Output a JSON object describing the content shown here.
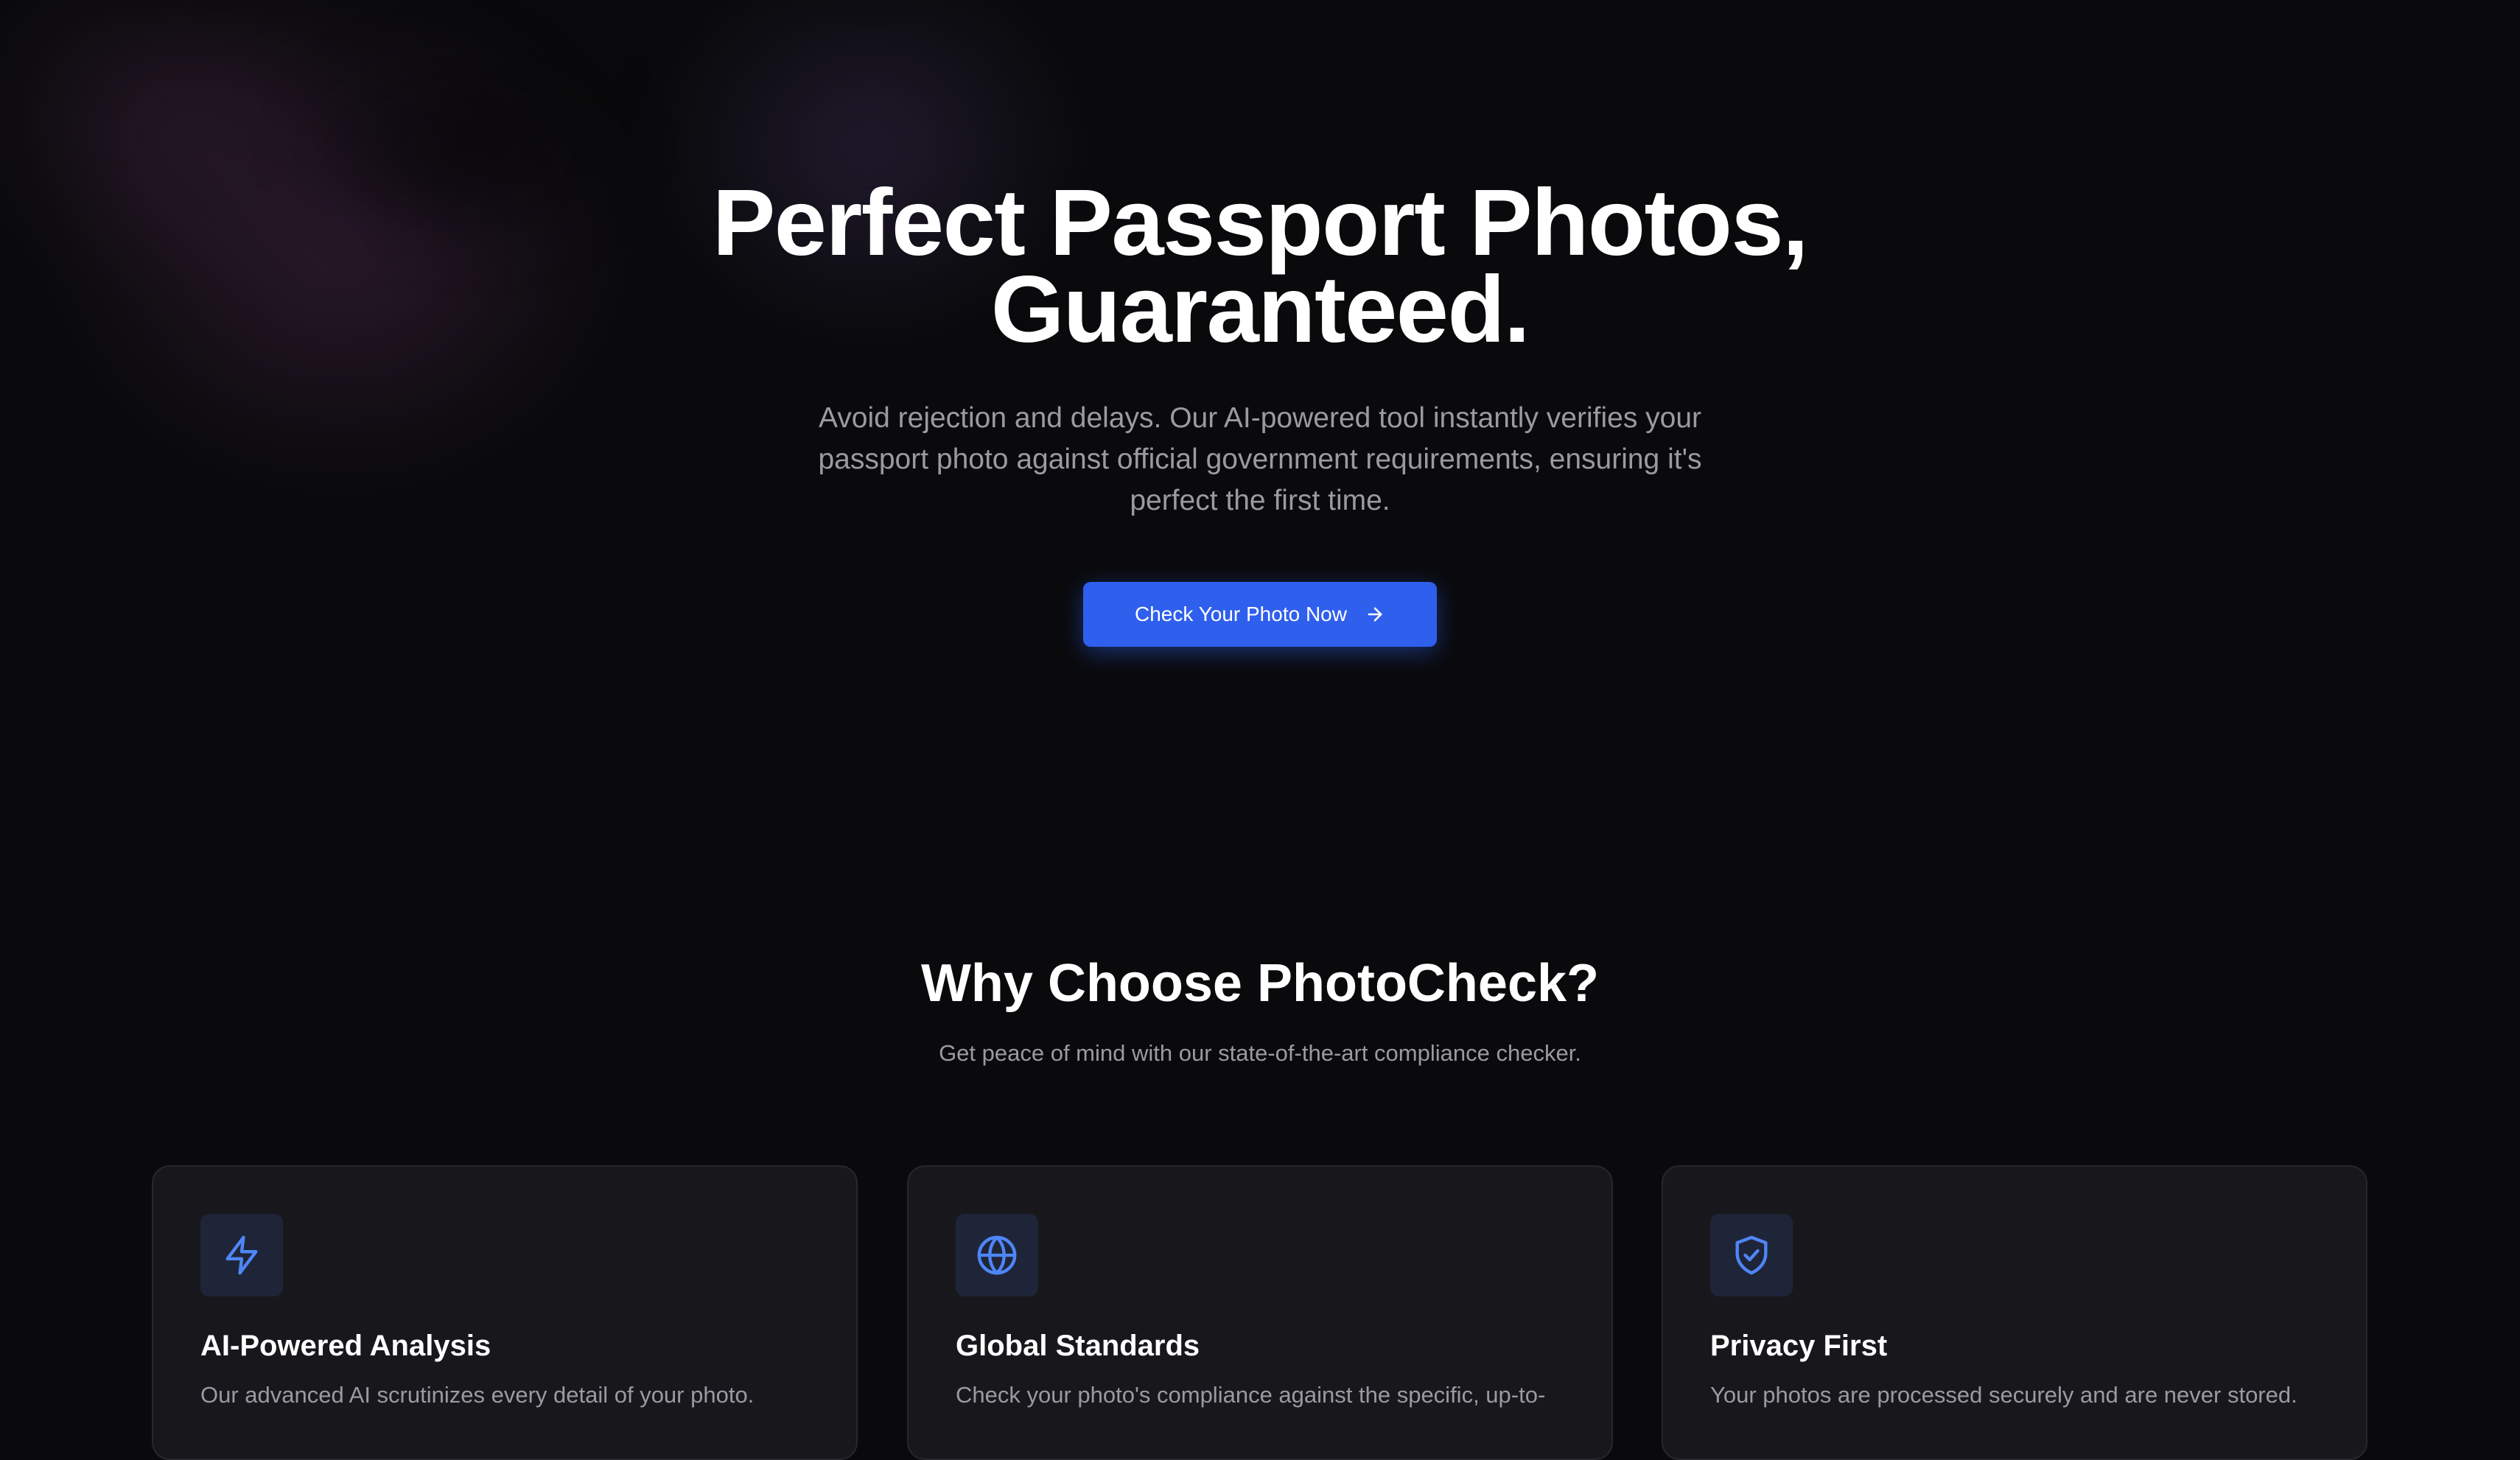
{
  "hero": {
    "title_line1": "Perfect Passport Photos,",
    "title_line2": "Guaranteed.",
    "subtitle": "Avoid rejection and delays. Our AI-powered tool instantly verifies your passport photo against official government requirements, ensuring it's perfect the first time.",
    "cta_label": "Check Your Photo Now",
    "cta_icon": "arrow-right-icon"
  },
  "features": {
    "title": "Why Choose PhotoCheck?",
    "subtitle": "Get peace of mind with our state-of-the-art compliance checker.",
    "cards": [
      {
        "icon": "lightning-icon",
        "title": "AI-Powered Analysis",
        "text": "Our advanced AI scrutinizes every detail of your photo."
      },
      {
        "icon": "globe-icon",
        "title": "Global Standards",
        "text": "Check your photo's compliance against the specific, up-to-"
      },
      {
        "icon": "shield-check-icon",
        "title": "Privacy First",
        "text": "Your photos are processed securely and are never stored."
      }
    ]
  },
  "colors": {
    "background": "#0a0a0c",
    "accent": "#2f5fed",
    "icon_blue": "#4f86f7",
    "card_bg": "#18181c",
    "muted_text": "#9a9aa2"
  }
}
